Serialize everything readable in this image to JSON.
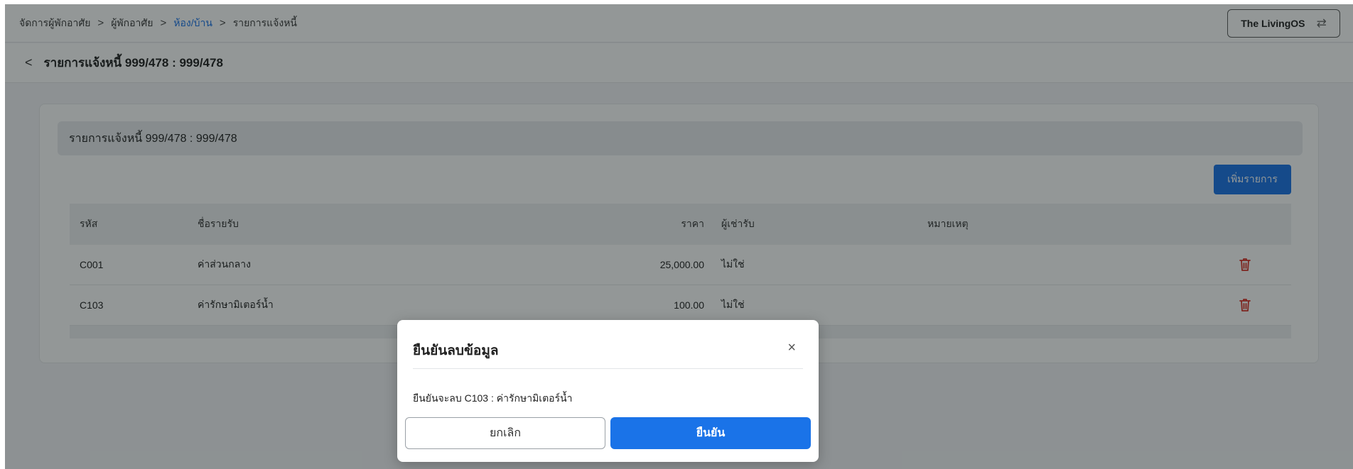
{
  "breadcrumb": [
    "จัดการผู้พักอาศัย",
    "ผู้พักอาศัย",
    "ห้อง/บ้าน",
    "รายการแจ้งหนี้"
  ],
  "org_switcher": {
    "label": "The LivingOS",
    "icon": "swap-icon"
  },
  "page": {
    "title": "รายการแจ้งหนี้ 999/478 : 999/478"
  },
  "card": {
    "title": "รายการแจ้งหนี้ 999/478 : 999/478",
    "add_label": "เพิ่มรายการ"
  },
  "table": {
    "headers": [
      "รหัส",
      "ชื่อรายรับ",
      "ราคา",
      "ผู้เช่ารับ",
      "หมายเหตุ"
    ],
    "rows": [
      {
        "code": "C001",
        "name": "ค่าส่วนกลาง",
        "price": "25,000.00",
        "tenant": "ไม่ใช่",
        "note": ""
      },
      {
        "code": "C103",
        "name": "ค่ารักษามิเตอร์น้ำ",
        "price": "100.00",
        "tenant": "ไม่ใช่",
        "note": ""
      }
    ]
  },
  "modal": {
    "title": "ยืนยันลบข้อมูล",
    "close": "×",
    "message": "ยืนยันจะลบ C103 : ค่ารักษามิเตอร์น้ำ",
    "cancel": "ยกเลิก",
    "confirm": "ยืนยัน"
  },
  "colors": {
    "accent": "#1a73e8",
    "danger": "#d93025"
  }
}
